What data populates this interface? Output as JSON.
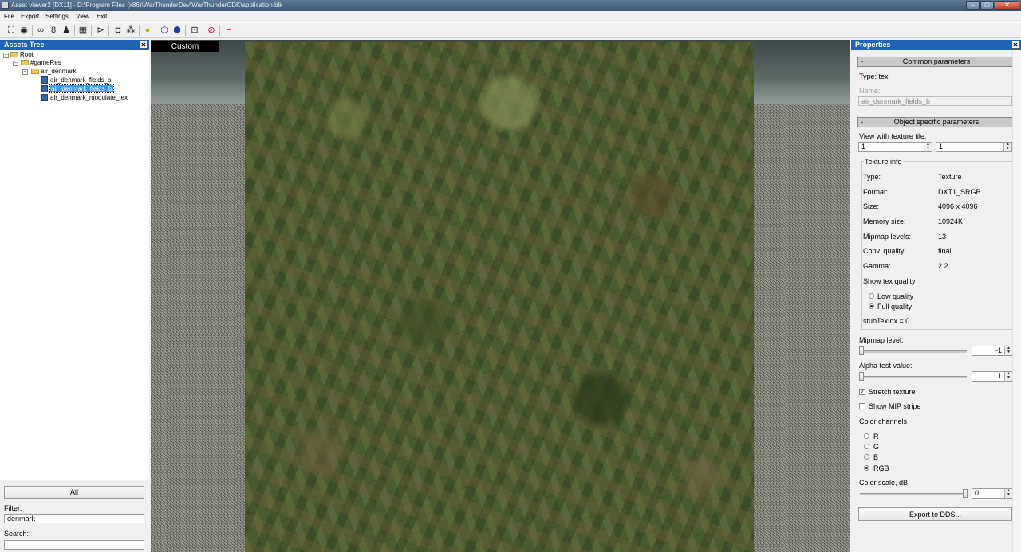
{
  "window": {
    "title": "Asset viewer2  [DX11]  - D:\\Program Files (x86)\\WarThunderDev\\WarThunderCDK\\application.blk",
    "min_glyph": "–",
    "max_glyph": "□",
    "close_glyph": "✕"
  },
  "menu": [
    "File",
    "Export",
    "Settings",
    "View",
    "Exit"
  ],
  "toolbar_icons": [
    "frame-icon",
    "eye-icon",
    "glasses-icon",
    "binoculars-icon",
    "figure-icon",
    "grid-icon",
    "navigate-icon",
    "camera-icon",
    "connect-icon",
    "light-icon",
    "cube-icon",
    "solid-cube-icon",
    "frame-select-icon",
    "no-texture-icon",
    "axes-icon"
  ],
  "assets_tree": {
    "title": "Assets Tree",
    "nodes": {
      "root": "Root",
      "gameres": "#gameRes",
      "folder": "air_denmark",
      "item_a": "air_denmark_fields_a",
      "item_b": "air_denmark_fields_b",
      "item_c": "air_denmark_modulate_tex"
    },
    "all_button": "All",
    "filter_label": "Filter:",
    "filter_value": "denmark",
    "search_label": "Search:",
    "search_value": ""
  },
  "viewport": {
    "mode_label": "Custom"
  },
  "properties": {
    "title": "Properties",
    "common": {
      "header": "Common parameters",
      "type_line": "Type: tex",
      "name_label": "Name:",
      "name_value": "air_denmark_fields_b"
    },
    "specific": {
      "header": "Object specific parameters",
      "tile_label": "View with texture tile:",
      "tile_x": "1",
      "tile_y": "1",
      "texinfo_title": "Texture info",
      "rows": [
        {
          "label": "Type:",
          "value": "Texture"
        },
        {
          "label": "Format:",
          "value": "DXT1_SRGB"
        },
        {
          "label": "Size:",
          "value": "4096 x 4096"
        },
        {
          "label": "Memory size:",
          "value": "10924K"
        },
        {
          "label": "Mipmap levels:",
          "value": "13"
        },
        {
          "label": "Conv. quality:",
          "value": "final"
        },
        {
          "label": "Gamma:",
          "value": "2.2"
        }
      ],
      "show_quality_label": "Show tex quality",
      "low_quality": "Low quality",
      "full_quality": "Full quality",
      "stub_line": "stubTexIdx = 0",
      "mipmap_label": "Mipmap level:",
      "mipmap_value": "-1",
      "alpha_label": "Alpha test value:",
      "alpha_value": "1",
      "stretch_label": "Stretch texture",
      "stretch_checked": true,
      "mip_stripe_label": "Show MIP stripe",
      "mip_stripe_checked": false,
      "color_channels_label": "Color channels",
      "channels": [
        "R",
        "G",
        "B",
        "RGB"
      ],
      "selected_channel": "RGB",
      "color_scale_label": "Color scale, dB",
      "color_scale_value": "0",
      "export_button": "Export to DDS..."
    }
  }
}
